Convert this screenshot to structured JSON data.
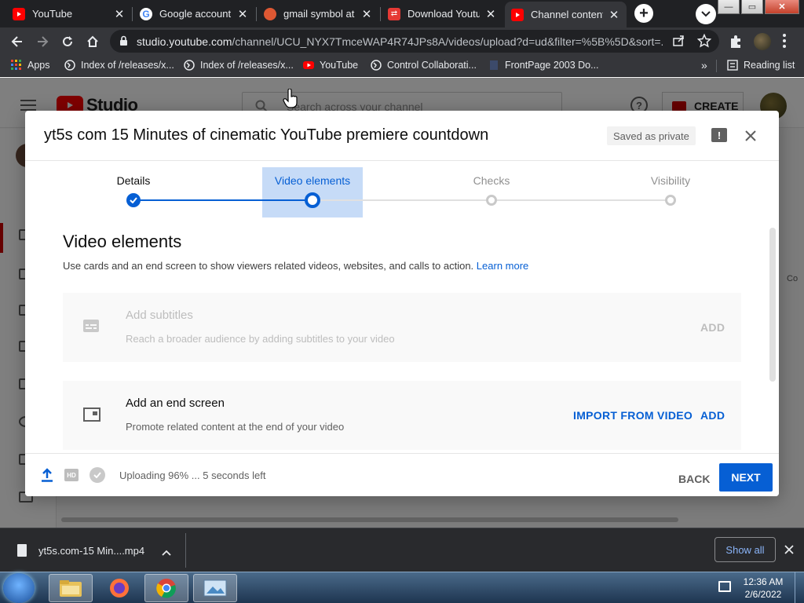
{
  "browser": {
    "tabs": [
      {
        "title": "YouTube",
        "active": false
      },
      {
        "title": "Google account i",
        "active": false
      },
      {
        "title": "gmail symbol at D",
        "active": false
      },
      {
        "title": "Download Youtub",
        "active": false
      },
      {
        "title": "Channel content",
        "active": true
      }
    ],
    "url_host": "studio.youtube.com",
    "url_path": "/channel/UCU_NYX7TmceWAP4R74JPs8A/videos/upload?d=ud&filter=%5B%5D&sort=...",
    "bookmarks": [
      {
        "label": "Apps",
        "icon": "apps-grid-icon"
      },
      {
        "label": "Index of /releases/x...",
        "icon": "globe-icon"
      },
      {
        "label": "Index of /releases/x...",
        "icon": "globe-icon"
      },
      {
        "label": "YouTube",
        "icon": "youtube-icon"
      },
      {
        "label": "Control Collaborati...",
        "icon": "globe-icon"
      },
      {
        "label": "FrontPage 2003 Do...",
        "icon": "page-icon"
      }
    ],
    "bookmarks_more": "»",
    "reading_list": "Reading list"
  },
  "studio": {
    "logo_text": "Studio",
    "search_placeholder": "Search across your channel",
    "create_label": "CREATE",
    "edge_text": "Co"
  },
  "dialog": {
    "title": "yt5s com 15 Minutes of cinematic YouTube premiere countdown",
    "saved_chip": "Saved as private",
    "steps": [
      {
        "label": "Details",
        "state": "done"
      },
      {
        "label": "Video elements",
        "state": "current"
      },
      {
        "label": "Checks",
        "state": "todo"
      },
      {
        "label": "Visibility",
        "state": "todo"
      }
    ],
    "section_title": "Video elements",
    "section_desc": "Use cards and an end screen to show viewers related videos, websites, and calls to action.",
    "learn_more": "Learn more",
    "cards": [
      {
        "title": "Add subtitles",
        "desc": "Reach a broader audience by adding subtitles to your video",
        "import_label": "",
        "add_label": "ADD",
        "enabled": false
      },
      {
        "title": "Add an end screen",
        "desc": "Promote related content at the end of your video",
        "import_label": "IMPORT FROM VIDEO",
        "add_label": "ADD",
        "enabled": true
      }
    ],
    "upload_status": "Uploading 96% ... 5 seconds left",
    "upload_progress_percent": 96,
    "hd_badge": "HD",
    "back_label": "BACK",
    "next_label": "NEXT"
  },
  "downloads": {
    "file_name": "yt5s.com-15 Min....mp4",
    "show_all": "Show all"
  },
  "taskbar": {
    "time": "12:36 AM",
    "date": "2/6/2022"
  },
  "colors": {
    "accent": "#065fd4",
    "youtube_red": "#ff0000",
    "step_highlight": "#c6dbf7"
  }
}
